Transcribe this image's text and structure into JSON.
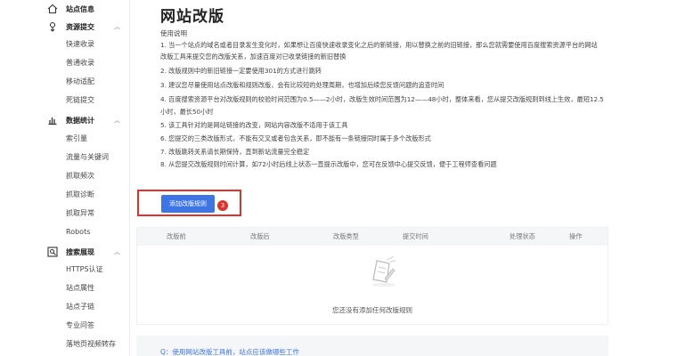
{
  "sidebar": {
    "groups": [
      {
        "label": "站点信息",
        "icon": "home-icon",
        "items": []
      },
      {
        "label": "资源提交",
        "icon": "submit-icon",
        "items": [
          "快速收录",
          "普通收录",
          "移动适配",
          "死链提交"
        ]
      },
      {
        "label": "数据统计",
        "icon": "bar-chart-icon",
        "items": [
          "索引量",
          "流量与关键词",
          "抓取频次",
          "抓取诊断",
          "抓取异常",
          "Robots"
        ]
      },
      {
        "label": "搜索展现",
        "icon": "search-display-icon",
        "items": [
          "HTTPS认证",
          "站点属性",
          "站点子链",
          "专业问答",
          "落地页视频转存"
        ]
      }
    ],
    "chevron": "︿"
  },
  "main": {
    "title": "网站改版",
    "intro": "使用说明",
    "rules": [
      "1. 当一个站点的域名或者目录发生变化时，如果想让百度快速收录变化之后的新链接，用以替换之前的旧链接，那么您就需要使用百度搜索资源平台的网站",
      "改版工具来提交您的改版关系，加速百度对已收录链接的新旧替换",
      "2. 改版规则中的新旧链接一定要使用301的方式进行跳转",
      "3. 建议您尽量使用站点改版和规则改版，会有比较短的处理周期，也增加后续您反馈问题的追查时间",
      "4. 百度搜索资源平台对改版规则的校验时间范围为0.5——2小时，改版生效时间范围为12——48小时，整体来看，您从提交改版规则到线上生效，最短12.5",
      "小时，最长50小时",
      "5. 该工具针对的是网站链接的改变，网站内容改版不适用于该工具",
      "6. 您提交的三类改版形式，不能有交叉或者包含关系，即不能有一条链接同时属于多个改版形式",
      "7. 改版跳转关系请长期保持，直到新站流量完全稳定",
      "8. 从您提交改版规则时间计算，如72小时后线上状态一直提示改版中，您可在反馈中心提交反馈，便于工程师查看问题"
    ],
    "add_button": "添加改版规则",
    "badge": "3",
    "table": {
      "columns": [
        "改版前",
        "改版后",
        "改版类型",
        "提交时间",
        "处理状态",
        "操作"
      ],
      "empty_text": "您还没有添加任何改版规则"
    },
    "faq_link": "Q：使用网站改版工具前，站点应该做哪些工作"
  },
  "colors": {
    "accent": "#3d74e6",
    "highlight": "#e0322b"
  }
}
